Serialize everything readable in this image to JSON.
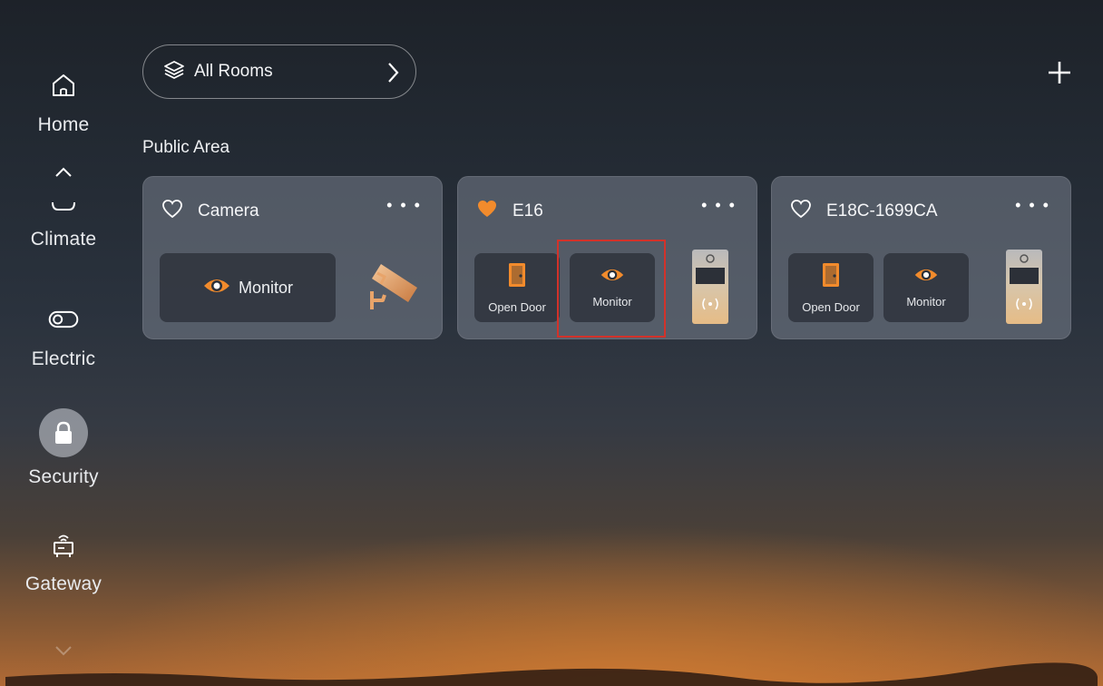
{
  "sidebar": {
    "items": [
      {
        "label": "Home",
        "icon": "home-icon"
      },
      {
        "label": "Climate",
        "icon": "climate-icon"
      },
      {
        "label": "Electric",
        "icon": "toggle-icon"
      },
      {
        "label": "Security",
        "icon": "lock-icon"
      },
      {
        "label": "Gateway",
        "icon": "router-icon"
      }
    ],
    "active": "Security"
  },
  "header": {
    "rooms_label": "All Rooms",
    "section_title": "Public Area"
  },
  "cards": [
    {
      "title": "Camera",
      "favorite": false,
      "monitor_label": "Monitor"
    },
    {
      "title": "E16",
      "favorite": true,
      "open_door_label": "Open Door",
      "monitor_label": "Monitor"
    },
    {
      "title": "E18C-1699CA",
      "favorite": false,
      "open_door_label": "Open Door",
      "monitor_label": "Monitor"
    }
  ],
  "colors": {
    "accent": "#f28b2c",
    "highlight_box": "#d2322a"
  }
}
